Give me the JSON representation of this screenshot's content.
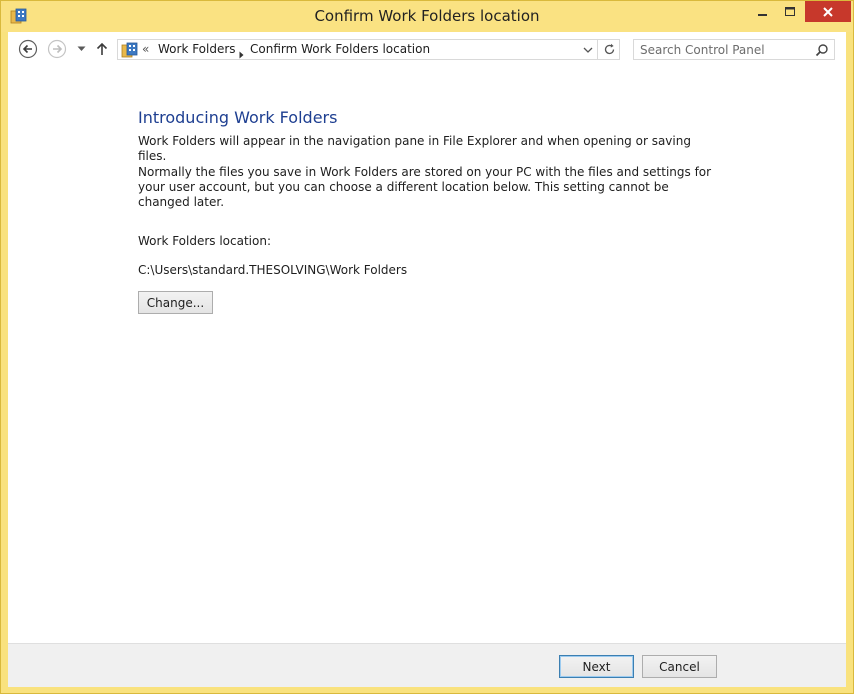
{
  "window": {
    "title": "Confirm Work Folders location",
    "accent_color": "#f9e27e",
    "close_color": "#c7382b"
  },
  "toolbar": {
    "back_icon": "back-arrow-icon",
    "forward_icon": "forward-arrow-icon",
    "recent_icon": "chevron-down-icon",
    "up_icon": "up-arrow-icon",
    "address": {
      "overflow": "«",
      "crumbs": [
        "Work Folders",
        "Confirm Work Folders location"
      ]
    },
    "search": {
      "placeholder": "Search Control Panel"
    }
  },
  "main": {
    "heading": "Introducing Work Folders",
    "heading_color": "#1e3f91",
    "paragraph1": "Work Folders will appear in the navigation pane in File Explorer and when opening or saving files.",
    "paragraph2": "Normally the files you save in Work Folders are stored on your PC with the files and settings for your user account, but you can choose a different location below. This setting cannot be changed later.",
    "location_label": "Work Folders location:",
    "location_value": "C:\\Users\\standard.THESOLVING\\Work Folders",
    "change_button": "Change..."
  },
  "footer": {
    "next_button": "Next",
    "cancel_button": "Cancel"
  }
}
